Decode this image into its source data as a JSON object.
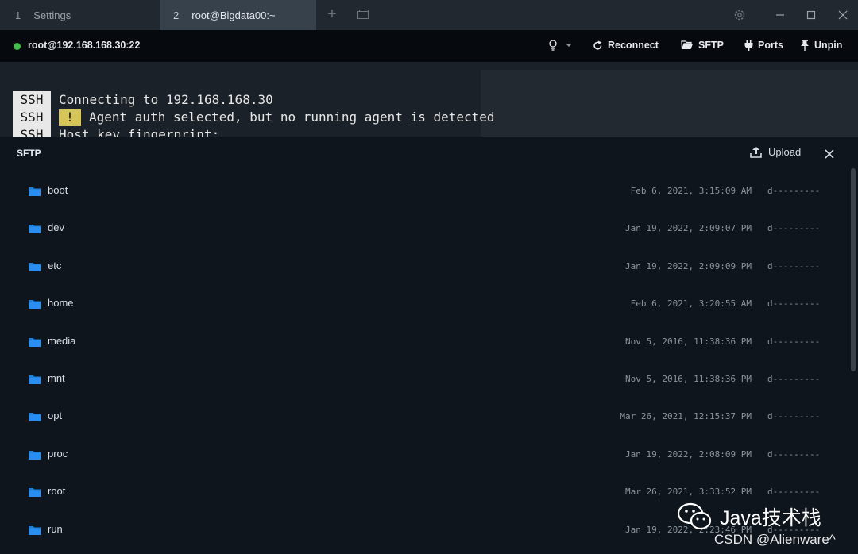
{
  "tabs": [
    {
      "num": "1",
      "label": "Settings"
    },
    {
      "num": "2",
      "label": "root@Bigdata00:~"
    }
  ],
  "window_icons": [
    "plus-icon",
    "window-icon",
    "gear-icon",
    "minimize-icon",
    "maximize-icon",
    "close-icon"
  ],
  "address": {
    "host": "root@192.168.168.30:22",
    "status_color": "#3fbf4a",
    "buttons": {
      "reconnect": "Reconnect",
      "sftp": "SFTP",
      "ports": "Ports",
      "unpin": "Unpin"
    }
  },
  "terminal": {
    "lines": [
      {
        "tag": "SSH",
        "text": "Connecting to 192.168.168.30"
      },
      {
        "tag": "SSH",
        "badge": "!",
        "text": "Agent auth selected, but no running agent is detected"
      },
      {
        "tag": "SSH",
        "text": "Host key fingerprint:"
      }
    ]
  },
  "sftp": {
    "title": "SFTP",
    "upload_label": "Upload",
    "files": [
      {
        "name": "boot",
        "date": "Feb 6, 2021, 3:15:09 AM",
        "perm": "d---------"
      },
      {
        "name": "dev",
        "date": "Jan 19, 2022, 2:09:07 PM",
        "perm": "d---------"
      },
      {
        "name": "etc",
        "date": "Jan 19, 2022, 2:09:09 PM",
        "perm": "d---------"
      },
      {
        "name": "home",
        "date": "Feb 6, 2021, 3:20:55 AM",
        "perm": "d---------"
      },
      {
        "name": "media",
        "date": "Nov 5, 2016, 11:38:36 PM",
        "perm": "d---------"
      },
      {
        "name": "mnt",
        "date": "Nov 5, 2016, 11:38:36 PM",
        "perm": "d---------"
      },
      {
        "name": "opt",
        "date": "Mar 26, 2021, 12:15:37 PM",
        "perm": "d---------"
      },
      {
        "name": "proc",
        "date": "Jan 19, 2022, 2:08:09 PM",
        "perm": "d---------"
      },
      {
        "name": "root",
        "date": "Mar 26, 2021, 3:33:52 PM",
        "perm": "d---------"
      },
      {
        "name": "run",
        "date": "Jan 19, 2022, 2:23:46 PM",
        "perm": "d---------"
      }
    ]
  },
  "watermark": {
    "brand": "Java技术栈",
    "credit": "CSDN @Alienware^"
  }
}
